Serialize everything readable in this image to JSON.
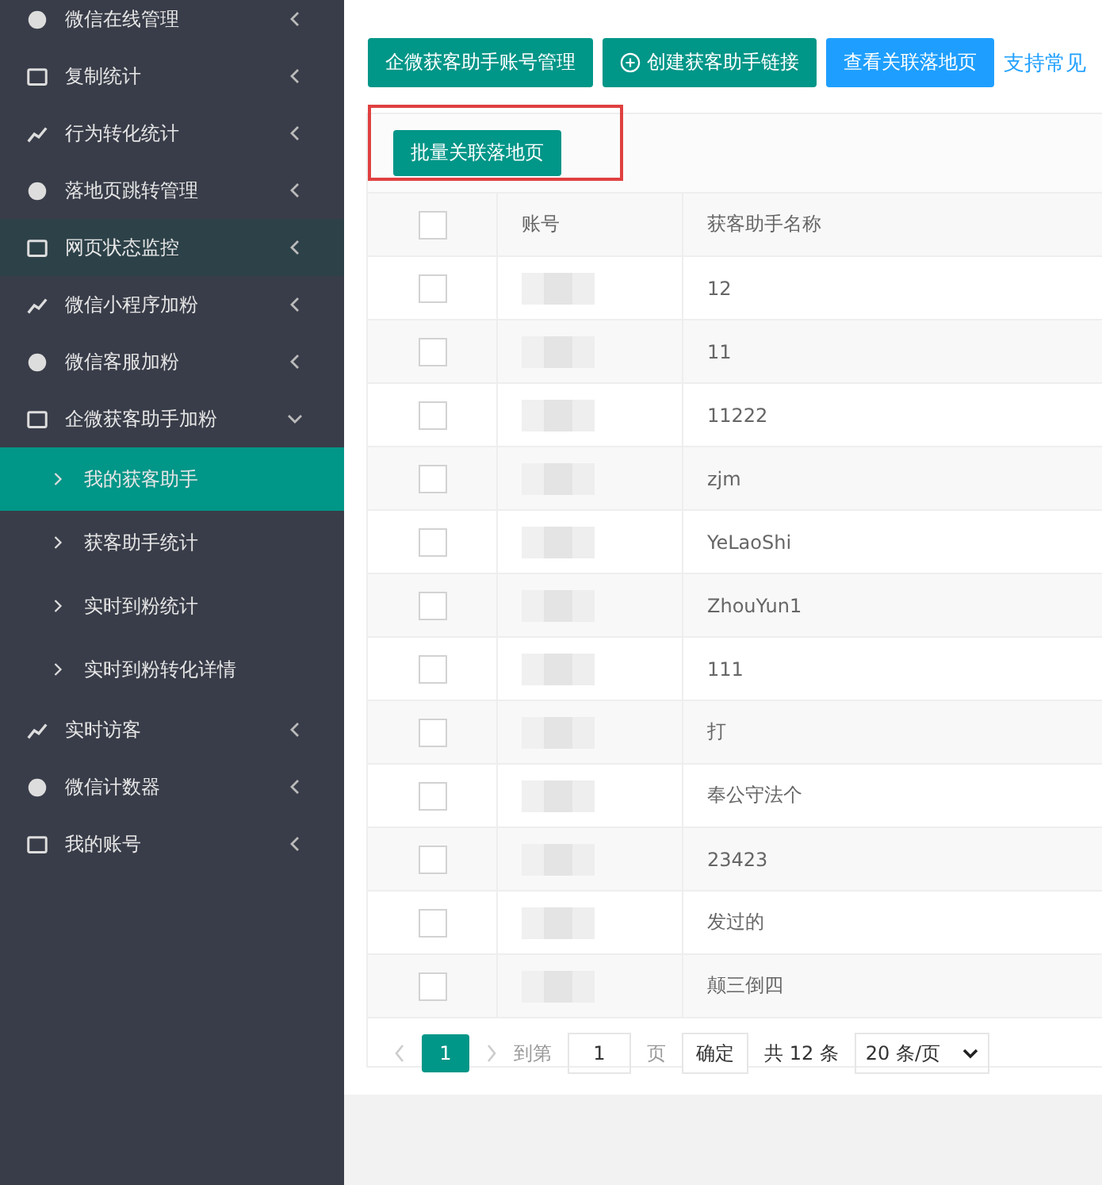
{
  "sidebar": {
    "items": [
      {
        "label": "微信在线管理",
        "highlighted": false,
        "expanded": false
      },
      {
        "label": "复制统计",
        "highlighted": false,
        "expanded": false
      },
      {
        "label": "行为转化统计",
        "highlighted": false,
        "expanded": false
      },
      {
        "label": "落地页跳转管理",
        "highlighted": false,
        "expanded": false
      },
      {
        "label": "网页状态监控",
        "highlighted": true,
        "expanded": false
      },
      {
        "label": "微信小程序加粉",
        "highlighted": false,
        "expanded": false
      },
      {
        "label": "微信客服加粉",
        "highlighted": false,
        "expanded": false
      },
      {
        "label": "企微获客助手加粉",
        "highlighted": false,
        "expanded": true,
        "children": [
          {
            "label": "我的获客助手",
            "selected": true
          },
          {
            "label": "获客助手统计",
            "selected": false
          },
          {
            "label": "实时到粉统计",
            "selected": false
          },
          {
            "label": "实时到粉转化详情",
            "selected": false
          }
        ]
      },
      {
        "label": "实时访客",
        "highlighted": false,
        "expanded": false
      },
      {
        "label": "微信计数器",
        "highlighted": false,
        "expanded": false
      },
      {
        "label": "我的账号",
        "highlighted": false,
        "expanded": false
      }
    ]
  },
  "toolbar": {
    "buttons": [
      {
        "label": "企微获客助手账号管理",
        "kind": "primary"
      },
      {
        "label": "创建获客助手链接",
        "kind": "add"
      },
      {
        "label": "查看关联落地页",
        "kind": "info"
      }
    ],
    "link": "支持常见"
  },
  "batch_button": "批量关联落地页",
  "table": {
    "columns": [
      "账号",
      "获客助手名称"
    ],
    "all_checked": false,
    "rows": [
      {
        "name": "12",
        "checked": false
      },
      {
        "name": "11",
        "checked": false
      },
      {
        "name": "11222",
        "checked": false
      },
      {
        "name": "zjm",
        "checked": false
      },
      {
        "name": "YeLaoShi",
        "checked": false
      },
      {
        "name": "ZhouYun1",
        "checked": false
      },
      {
        "name": "111",
        "checked": false
      },
      {
        "name": "打",
        "checked": false
      },
      {
        "name": "奉公守法个",
        "checked": false
      },
      {
        "name": "23423",
        "checked": false
      },
      {
        "name": "发过的",
        "checked": false
      },
      {
        "name": "颠三倒四",
        "checked": false
      }
    ]
  },
  "pagination": {
    "current": "1",
    "goto_label": "到第",
    "goto_value": "1",
    "page_label": "页",
    "confirm": "确定",
    "total": "共 12 条",
    "page_size": "20 条/页"
  }
}
